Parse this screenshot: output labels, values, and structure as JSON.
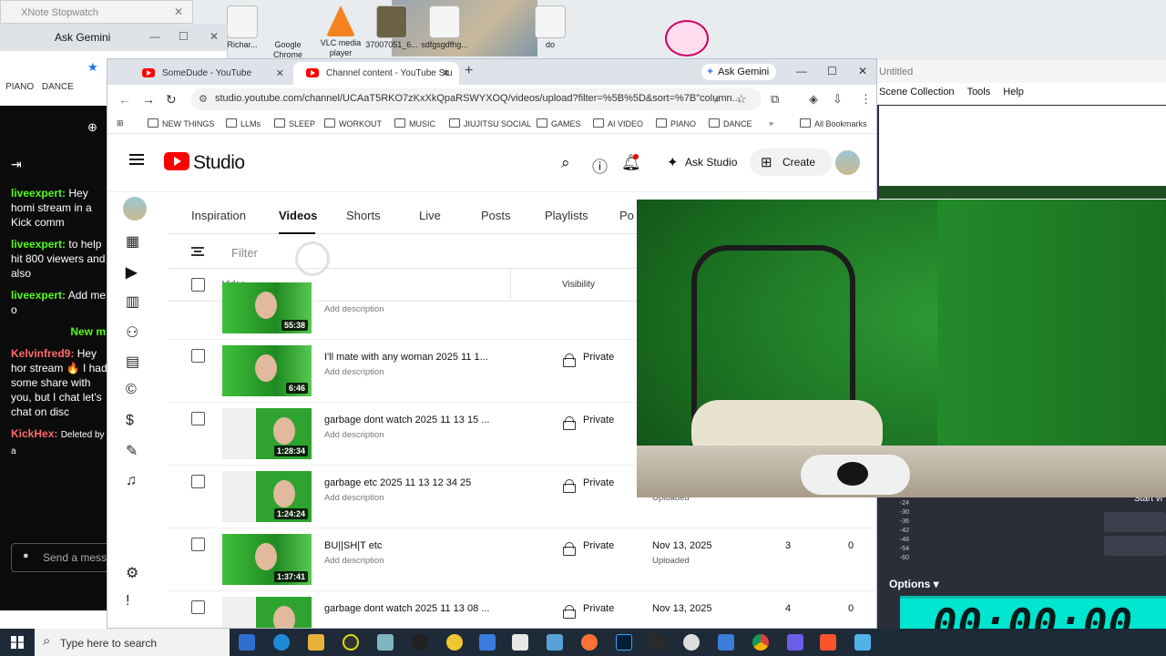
{
  "desktop": {
    "icons": [
      {
        "label": "Richar..."
      },
      {
        "label": "Google Chrome"
      },
      {
        "label": "VLC media player"
      },
      {
        "label": "37007051_6..."
      },
      {
        "label": "sdfgsgdfhg..."
      },
      {
        "label": "do"
      }
    ]
  },
  "xnote_window": {
    "title": "XNote Stopwatch"
  },
  "left_browser": {
    "gemini": "Ask Gemini",
    "bookmarks": [
      "PIANO",
      "DANCE"
    ]
  },
  "chat": {
    "messages": [
      {
        "user": "liveexpert:",
        "text": "Hey homi stream in a Kick comm"
      },
      {
        "user": "liveexpert:",
        "text": "to help hit 800 viewers and also"
      },
      {
        "user": "liveexpert:",
        "text": "Add me o"
      }
    ],
    "new_label": "New m",
    "messages2": [
      {
        "user": "Kelvinfred9:",
        "text": "Hey hor stream 🔥 I had some share with you, but I chat let's chat on disc"
      },
      {
        "user": "KickHex:",
        "text": "Deleted by a"
      }
    ],
    "input_placeholder": "Send a messa"
  },
  "obs": {
    "title": "Untitled",
    "menu": [
      "Scene Collection",
      "Tools",
      "Help"
    ],
    "meter_labels": [
      "-24",
      "-30",
      "-36",
      "-42",
      "-48",
      "-54",
      "-60"
    ],
    "options_label": "Options ▾",
    "start_label": "Start vi"
  },
  "stopwatch": {
    "time": "00:00:00"
  },
  "browser": {
    "tabs": [
      {
        "title": "SomeDude - YouTube"
      },
      {
        "title": "Channel content - YouTube Stu"
      }
    ],
    "gemini": "Ask Gemini",
    "url": "studio.youtube.com/channel/UCAaT5RKO7zKxXkQpaRSWYXOQ/videos/upload?filter=%5B%5D&sort=%7B\"column...",
    "bookmarks": [
      "NEW THINGS",
      "LLMs",
      "SLEEP",
      "WORKOUT",
      "MUSIC",
      "JIUJITSU SOCIAL",
      "GAMES",
      "AI VIDEO",
      "PIANO",
      "DANCE"
    ],
    "all_bookmarks": "All Bookmarks"
  },
  "studio": {
    "logo_text": "Studio",
    "ask_studio": "Ask Studio",
    "create": "Create",
    "tabs": [
      "Inspiration",
      "Videos",
      "Shorts",
      "Live",
      "Posts",
      "Playlists",
      "Po"
    ],
    "active_tab": "Videos",
    "filter_label": "Filter",
    "columns": {
      "video": "Video",
      "visibility": "Visibility"
    },
    "rows": [
      {
        "title": "",
        "desc": "Add description",
        "duration": "55:38",
        "visibility": "",
        "date": "",
        "date_sub": "",
        "views": "",
        "comments": ""
      },
      {
        "title": "I'll mate with any woman 2025 11 1...",
        "desc": "Add description",
        "duration": "6:46",
        "visibility": "Private",
        "date": "",
        "date_sub": "",
        "views": "",
        "comments": ""
      },
      {
        "title": "garbage dont watch 2025 11 13 15 ...",
        "desc": "Add description",
        "duration": "1:28:34",
        "visibility": "Private",
        "date": "",
        "date_sub": "",
        "views": "",
        "comments": ""
      },
      {
        "title": "garbage etc 2025 11 13 12 34 25",
        "desc": "Add description",
        "duration": "1:24:24",
        "visibility": "Private",
        "date": "",
        "date_sub": "Uploaded",
        "views": "",
        "comments": ""
      },
      {
        "title": "BU||SH|T etc",
        "desc": "Add description",
        "duration": "1:37:41",
        "visibility": "Private",
        "date": "Nov 13, 2025",
        "date_sub": "Uploaded",
        "views": "3",
        "comments": "0"
      },
      {
        "title": "garbage dont watch 2025 11 13 08 ...",
        "desc": "",
        "duration": "",
        "visibility": "Private",
        "date": "Nov 13, 2025",
        "date_sub": "",
        "views": "4",
        "comments": "0"
      }
    ]
  },
  "taskbar": {
    "search_placeholder": "Type here to search"
  }
}
